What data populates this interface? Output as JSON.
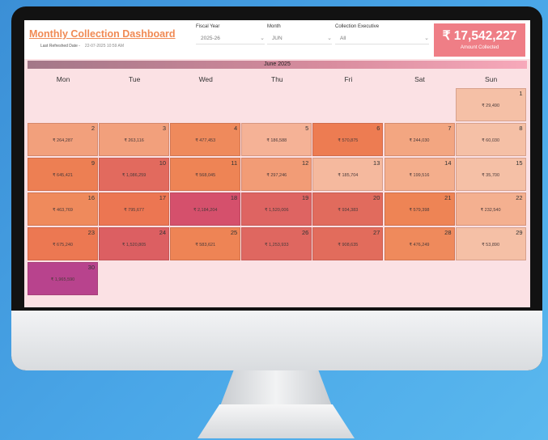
{
  "header": {
    "title": "Monthly Collection Dashboard",
    "refresh_label": "Last Refreshed Date -",
    "refresh_value": "22-07-2025 10:59 AM"
  },
  "filters": {
    "fiscal_year": {
      "label": "Fiscal Year",
      "value": "2025-26"
    },
    "month": {
      "label": "Month",
      "value": "JUN"
    },
    "executive": {
      "label": "Collection Executive",
      "value": "All"
    }
  },
  "kpi": {
    "value": "₹ 17,542,227",
    "caption": "Amount Collected"
  },
  "calendar": {
    "month_title": "June 2025",
    "weekdays": [
      "Mon",
      "Tue",
      "Wed",
      "Thu",
      "Fri",
      "Sat",
      "Sun"
    ],
    "days": [
      {
        "day": "1",
        "amount": "₹ 29,490",
        "color": "#f5c0a6"
      },
      {
        "day": "2",
        "amount": "₹ 264,287",
        "color": "#f2a07c"
      },
      {
        "day": "3",
        "amount": "₹ 263,116",
        "color": "#f2a07c"
      },
      {
        "day": "4",
        "amount": "₹ 477,453",
        "color": "#ef8a5c"
      },
      {
        "day": "5",
        "amount": "₹ 186,588",
        "color": "#f5b296"
      },
      {
        "day": "6",
        "amount": "₹ 570,875",
        "color": "#ed7c52"
      },
      {
        "day": "7",
        "amount": "₹ 244,030",
        "color": "#f3a681"
      },
      {
        "day": "8",
        "amount": "₹ 60,030",
        "color": "#f5c0a6"
      },
      {
        "day": "9",
        "amount": "₹ 645,421",
        "color": "#ed7f53"
      },
      {
        "day": "10",
        "amount": "₹ 1,086,259",
        "color": "#e26a5e"
      },
      {
        "day": "11",
        "amount": "₹ 568,045",
        "color": "#ee8455"
      },
      {
        "day": "12",
        "amount": "₹ 297,246",
        "color": "#f29c76"
      },
      {
        "day": "13",
        "amount": "₹ 185,704",
        "color": "#f5b99e"
      },
      {
        "day": "14",
        "amount": "₹ 199,516",
        "color": "#f4ae8c"
      },
      {
        "day": "15",
        "amount": "₹ 35,700",
        "color": "#f5c0a6"
      },
      {
        "day": "16",
        "amount": "₹ 463,769",
        "color": "#ef8a5c"
      },
      {
        "day": "17",
        "amount": "₹ 795,677",
        "color": "#ec7652"
      },
      {
        "day": "18",
        "amount": "₹ 2,184,204",
        "color": "#d5506c"
      },
      {
        "day": "19",
        "amount": "₹ 1,520,006",
        "color": "#de6462"
      },
      {
        "day": "20",
        "amount": "₹ 934,383",
        "color": "#e16b5d"
      },
      {
        "day": "21",
        "amount": "₹ 579,398",
        "color": "#ee8455"
      },
      {
        "day": "22",
        "amount": "₹ 232,540",
        "color": "#f4b090"
      },
      {
        "day": "23",
        "amount": "₹ 675,240",
        "color": "#ec7852"
      },
      {
        "day": "24",
        "amount": "₹ 1,520,805",
        "color": "#dc5f62"
      },
      {
        "day": "25",
        "amount": "₹ 583,621",
        "color": "#ee8455"
      },
      {
        "day": "26",
        "amount": "₹ 1,253,933",
        "color": "#df6760"
      },
      {
        "day": "27",
        "amount": "₹ 908,635",
        "color": "#e26c5c"
      },
      {
        "day": "28",
        "amount": "₹ 476,249",
        "color": "#ef8a5c"
      },
      {
        "day": "29",
        "amount": "₹ 53,890",
        "color": "#f5c0a6"
      },
      {
        "day": "30",
        "amount": "₹ 1,965,590",
        "color": "#b8438d"
      }
    ]
  }
}
